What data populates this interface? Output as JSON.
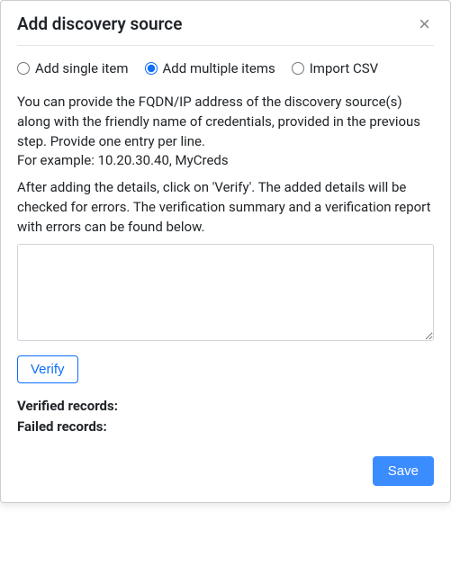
{
  "modal": {
    "title": "Add discovery source",
    "close_label": "×"
  },
  "options": {
    "single": "Add single item",
    "multiple": "Add multiple items",
    "import": "Import CSV",
    "selected": "multiple"
  },
  "help": {
    "para1": "You can provide the FQDN/IP address of the discovery source(s) along with the friendly name of credentials, provided in the previous step. Provide one entry per line.",
    "example": "For example: 10.20.30.40, MyCreds",
    "para2": "After adding the details, click on 'Verify'. The added details will be checked for errors. The verification summary and a verification report with errors can be found below."
  },
  "textarea": {
    "value": "",
    "placeholder": ""
  },
  "buttons": {
    "verify": "Verify",
    "save": "Save"
  },
  "summary": {
    "verified_label": "Verified records:",
    "verified_value": "",
    "failed_label": "Failed records:",
    "failed_value": ""
  }
}
